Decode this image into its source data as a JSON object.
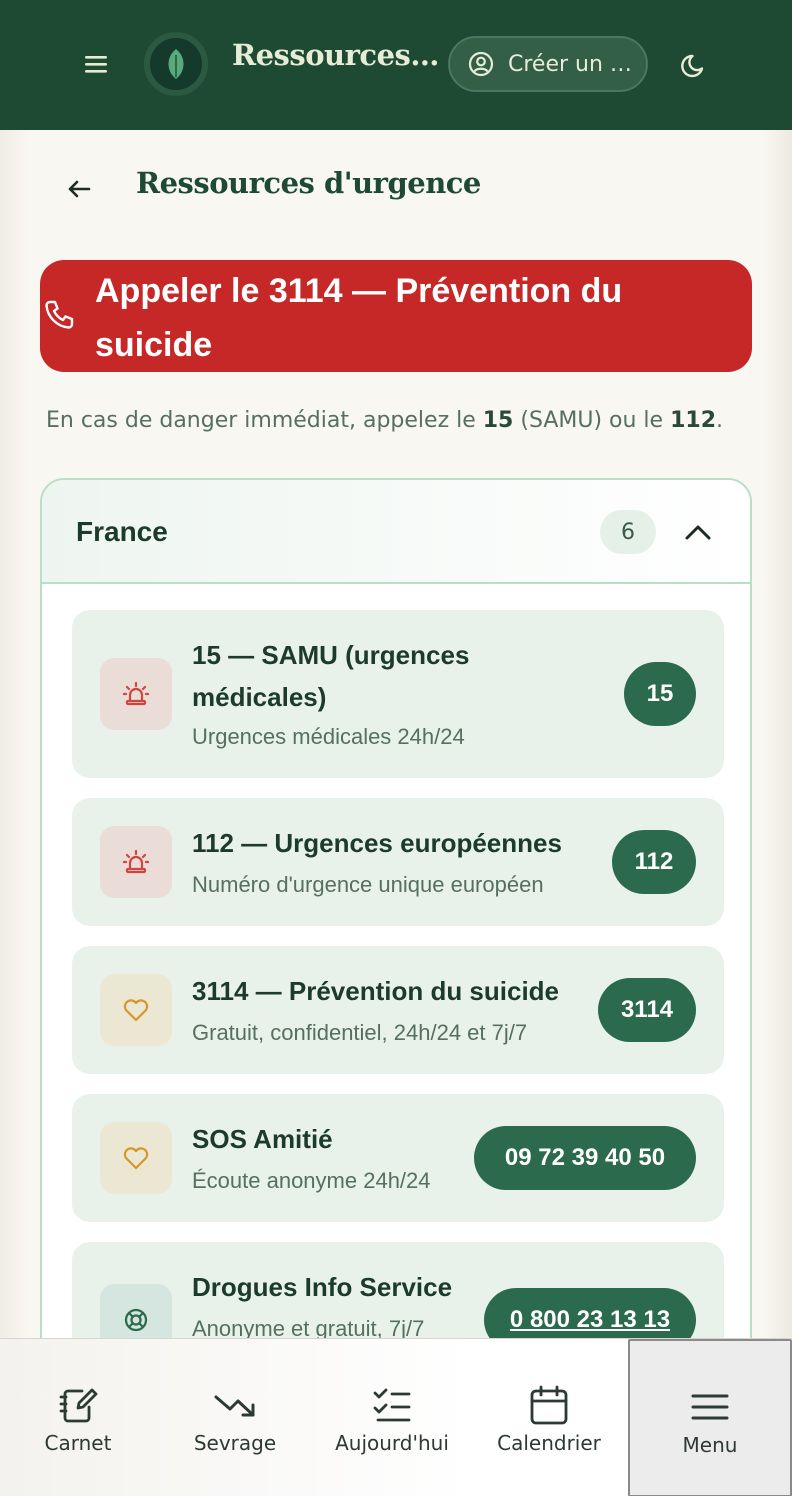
{
  "header": {
    "app_title": "Ressources…",
    "account_label": "Créer un …"
  },
  "page": {
    "title": "Ressources d'urgence"
  },
  "call_banner": {
    "label": "Appeler le 3114 — Prévention du suicide"
  },
  "danger_note": {
    "prefix": "En cas de danger immédiat, appelez le ",
    "num1": "15",
    "mid": " (SAMU) ou le ",
    "num2": "112",
    "suffix": "."
  },
  "country": {
    "name": "France",
    "count": "6",
    "items": [
      {
        "title": "15 — SAMU (urgences médicales)",
        "subtitle": "Urgences médicales 24h/24",
        "number": "15",
        "icon": "siren-icon",
        "tone": "red"
      },
      {
        "title": "112 — Urgences européennes",
        "subtitle": "Numéro d'urgence unique européen",
        "number": "112",
        "icon": "siren-icon",
        "tone": "red"
      },
      {
        "title": "3114 — Prévention du suicide",
        "subtitle": "Gratuit, confidentiel, 24h/24 et 7j/7",
        "number": "3114",
        "icon": "heart-icon",
        "tone": "yellow"
      },
      {
        "title": "SOS Amitié",
        "subtitle": "Écoute anonyme 24h/24",
        "number": "09 72 39 40 50",
        "icon": "heart-icon",
        "tone": "yellow"
      },
      {
        "title": "Drogues Info Service",
        "subtitle": "Anonyme et gratuit, 7j/7",
        "number": "0 800 23 13 13",
        "icon": "lifebuoy-icon",
        "tone": "teal"
      }
    ]
  },
  "bottom_nav": [
    {
      "label": "Carnet",
      "icon": "notebook-pen-icon"
    },
    {
      "label": "Sevrage",
      "icon": "trending-down-icon"
    },
    {
      "label": "Aujourd'hui",
      "icon": "checklist-icon"
    },
    {
      "label": "Calendrier",
      "icon": "calendar-icon"
    },
    {
      "label": "Menu",
      "icon": "menu-icon",
      "active": true
    }
  ],
  "colors": {
    "header_bg": "#1e4a33",
    "accent_green": "#2b6a4c",
    "danger_red": "#c62828",
    "item_bg": "#e8f2eb"
  }
}
